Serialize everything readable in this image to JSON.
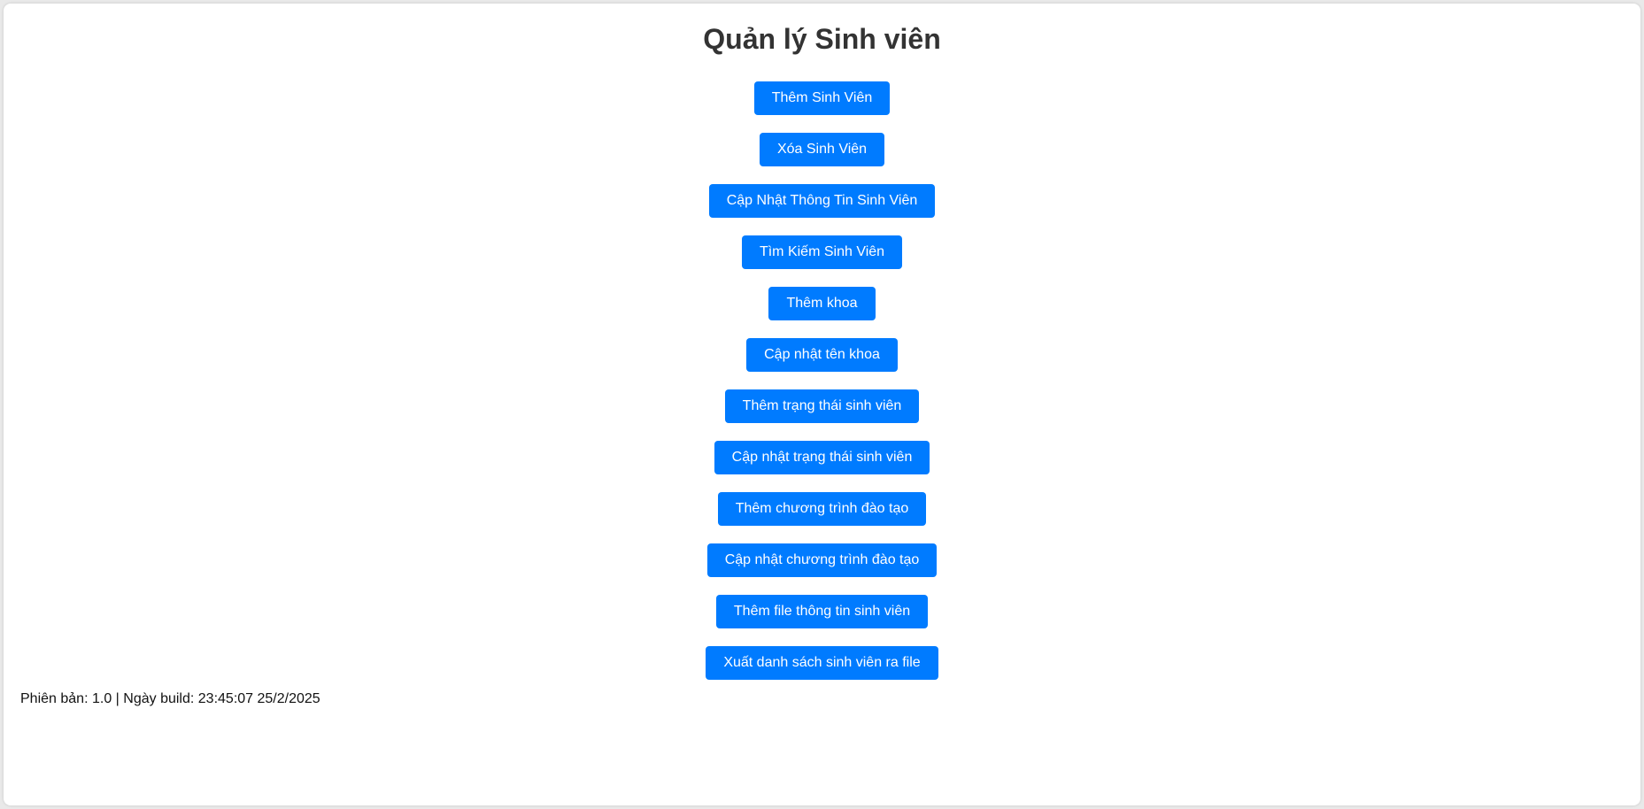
{
  "page": {
    "title": "Quản lý Sinh viên"
  },
  "menu": {
    "buttons": [
      {
        "label": "Thêm Sinh Viên"
      },
      {
        "label": "Xóa Sinh Viên"
      },
      {
        "label": "Cập Nhật Thông Tin Sinh Viên"
      },
      {
        "label": "Tìm Kiếm Sinh Viên"
      },
      {
        "label": "Thêm khoa"
      },
      {
        "label": "Cập nhật tên khoa"
      },
      {
        "label": "Thêm trạng thái sinh viên"
      },
      {
        "label": "Cập nhật trạng thái sinh viên"
      },
      {
        "label": "Thêm chương trình đào tạo"
      },
      {
        "label": "Cập nhật chương trình đào tạo"
      },
      {
        "label": "Thêm file thông tin sinh viên"
      },
      {
        "label": "Xuất danh sách sinh viên ra file"
      }
    ]
  },
  "footer": {
    "version_label": "Phiên bản:",
    "version": "1.0",
    "separator": "|",
    "build_label": "Ngày build:",
    "build_date": "23:45:07 25/2/2025"
  },
  "colors": {
    "button_bg": "#007bff",
    "button_text": "#ffffff",
    "title_text": "#333333"
  }
}
